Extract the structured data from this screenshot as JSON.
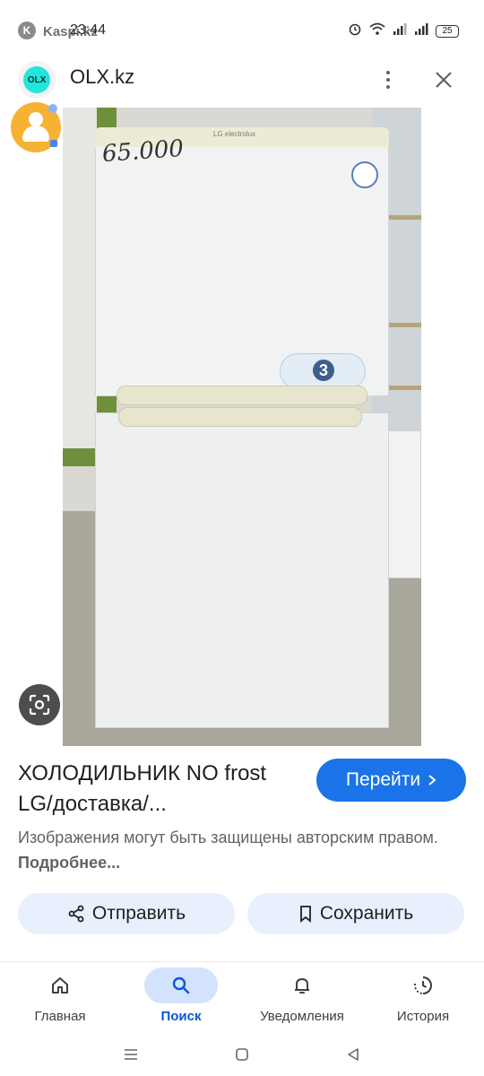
{
  "status_bar": {
    "kaspi_text": "Kaspi.kz",
    "time": "23:44",
    "battery": "25"
  },
  "header": {
    "site_logo_text": "OLX",
    "title": "OLX.kz"
  },
  "image": {
    "handwritten_price": "65.000",
    "brand_text": "LG electrolux",
    "badge_number": "3"
  },
  "listing": {
    "title": "ХОЛОДИЛЬНИК NO frost LG/доставка/...",
    "go_button": "Перейти",
    "copyright_text": "Изображения могут быть защищены авторским правом.",
    "copyright_link": "Подробнее..."
  },
  "actions": {
    "share": "Отправить",
    "save": "Сохранить"
  },
  "bottom_nav": {
    "items": [
      {
        "label": "Главная",
        "icon": "home-icon"
      },
      {
        "label": "Поиск",
        "icon": "search-icon",
        "active": true
      },
      {
        "label": "Уведомления",
        "icon": "bell-icon"
      },
      {
        "label": "История",
        "icon": "history-icon"
      }
    ]
  },
  "colors": {
    "accent": "#1a73e8",
    "chip_bg": "#e8f0fe",
    "active_nav_bg": "#d3e3fd",
    "olx_logo": "#23e5db"
  }
}
